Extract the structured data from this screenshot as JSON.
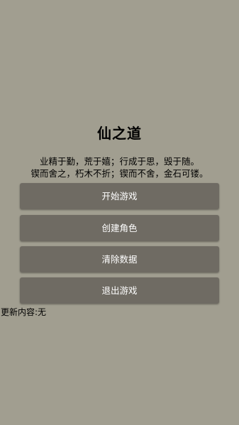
{
  "title": "仙之道",
  "motto": {
    "line1": "业精于勤，荒于嬉；行成于思，毁于随。",
    "line2": "锲而舍之，朽木不折；锲而不舍，金石可镂。"
  },
  "menu": {
    "start_label": "开始游戏",
    "create_label": "创建角色",
    "clear_label": "清除数据",
    "exit_label": "退出游戏"
  },
  "update_note": "更新内容:无",
  "colors": {
    "background": "#a19e90",
    "button": "#6f6b63",
    "button_text": "#ffffff"
  }
}
